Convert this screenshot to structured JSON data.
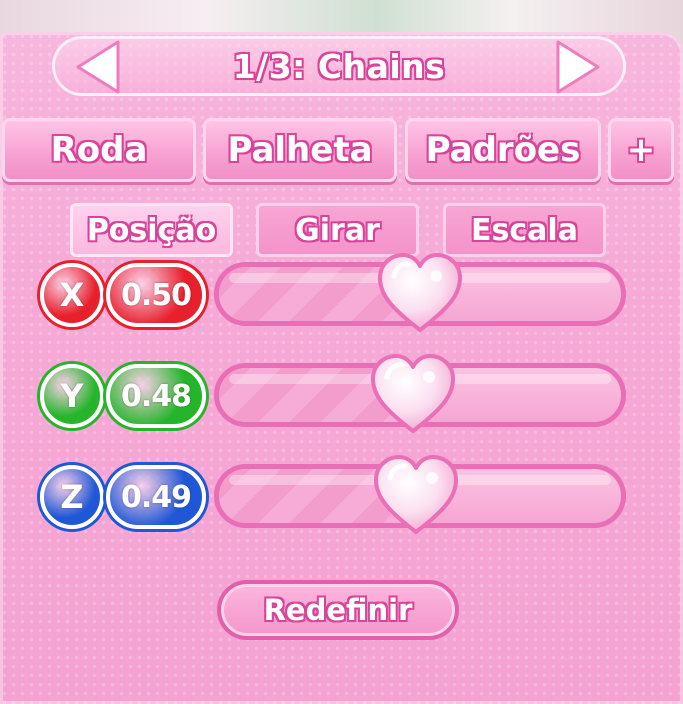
{
  "header": {
    "title": "1/3: Chains",
    "prev_icon": "arrow-left-icon",
    "next_icon": "arrow-right-icon"
  },
  "tabs": [
    {
      "label": "Roda"
    },
    {
      "label": "Palheta"
    },
    {
      "label": "Padrões"
    },
    {
      "label": "+"
    }
  ],
  "subtabs": [
    {
      "label": "Posição",
      "active": true
    },
    {
      "label": "Girar",
      "active": false
    },
    {
      "label": "Escala",
      "active": false
    }
  ],
  "sliders": [
    {
      "axis": "X",
      "value": "0.50",
      "level": 0.5,
      "color": "#e8202c"
    },
    {
      "axis": "Y",
      "value": "0.48",
      "level": 0.48,
      "color": "#25b52a"
    },
    {
      "axis": "Z",
      "value": "0.49",
      "level": 0.49,
      "color": "#1f57d6"
    }
  ],
  "reset_label": "Redefinir",
  "colors": {
    "panel": "#f6a9d6",
    "accent": "#e86eb5",
    "knob": "#fbe3f1"
  }
}
